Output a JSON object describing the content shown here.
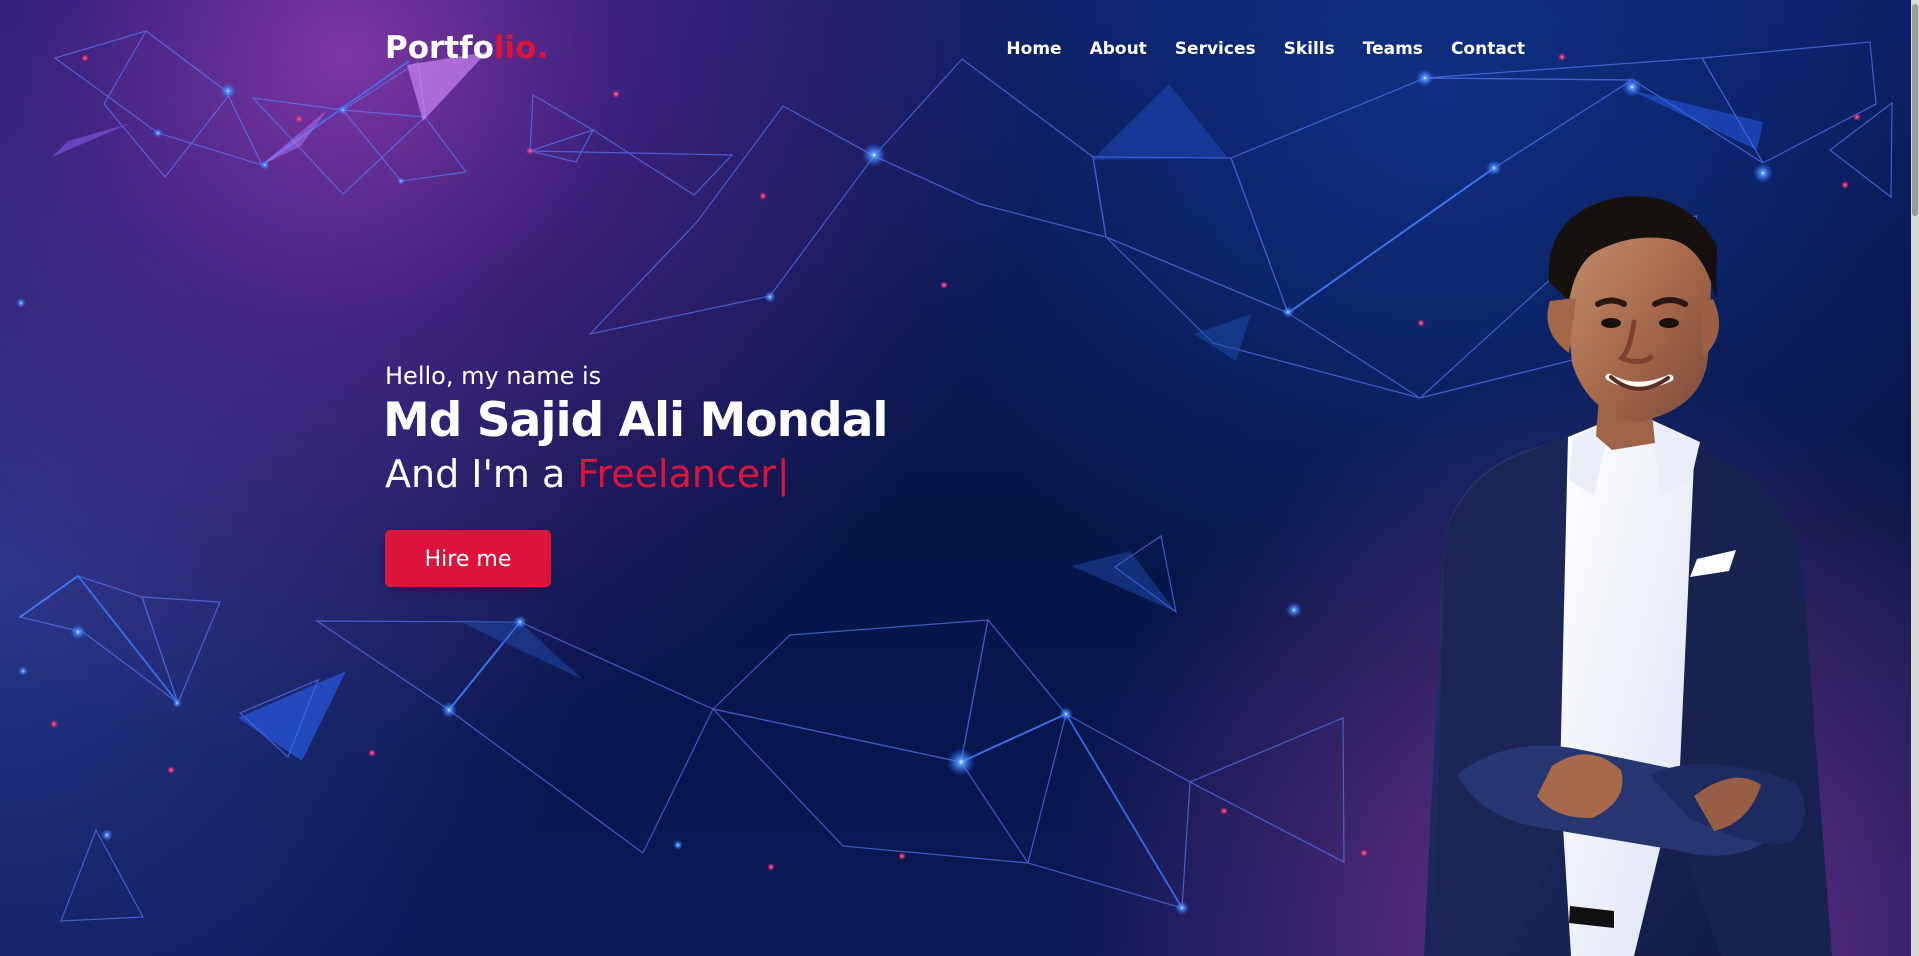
{
  "brand": {
    "text_main": "Portfo",
    "text_accent": "lio."
  },
  "navigation": {
    "items": [
      {
        "label": "Home"
      },
      {
        "label": "About"
      },
      {
        "label": "Services"
      },
      {
        "label": "Skills"
      },
      {
        "label": "Teams"
      },
      {
        "label": "Contact"
      }
    ]
  },
  "hero": {
    "greeting": "Hello, my name is",
    "name": "Md Sajid Ali Mondal",
    "role_prefix": "And I'm a ",
    "role": "Freelancer",
    "cursor": "|",
    "cta_label": "Hire me"
  },
  "colors": {
    "accent": "#dc143c",
    "background_navy": "#061646",
    "background_purple": "#8a2fb0",
    "network_blue": "#4476ff",
    "text": "#ffffff"
  },
  "icons": {
    "portrait": "person-photo",
    "background": "network-lines"
  }
}
